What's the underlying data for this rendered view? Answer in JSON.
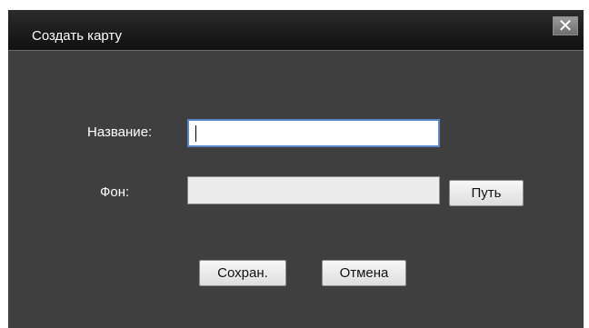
{
  "dialog": {
    "title": "Создать карту",
    "close_label": "✕"
  },
  "form": {
    "name_label": "Название:",
    "name_value": "",
    "background_label": "Фон:",
    "background_value": "",
    "path_button": "Путь"
  },
  "actions": {
    "save_label": "Сохран.",
    "cancel_label": "Отмена"
  }
}
